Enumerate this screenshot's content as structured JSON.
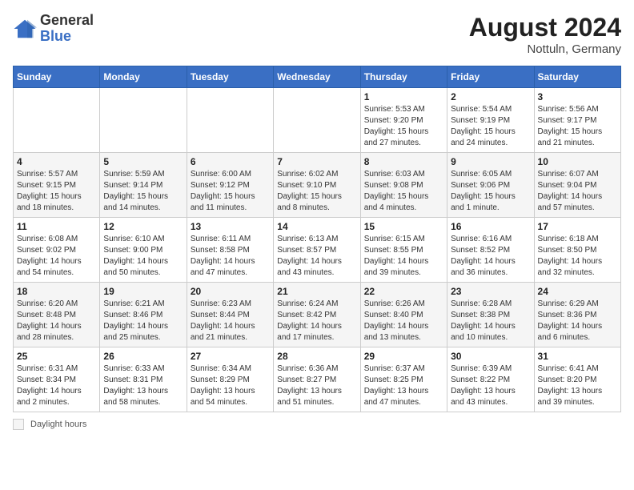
{
  "header": {
    "logo_general": "General",
    "logo_blue": "Blue",
    "month_year": "August 2024",
    "location": "Nottuln, Germany"
  },
  "footer": {
    "daylight_label": "Daylight hours"
  },
  "days_of_week": [
    "Sunday",
    "Monday",
    "Tuesday",
    "Wednesday",
    "Thursday",
    "Friday",
    "Saturday"
  ],
  "weeks": [
    [
      {
        "day": "",
        "sunrise": "",
        "sunset": "",
        "daylight": ""
      },
      {
        "day": "",
        "sunrise": "",
        "sunset": "",
        "daylight": ""
      },
      {
        "day": "",
        "sunrise": "",
        "sunset": "",
        "daylight": ""
      },
      {
        "day": "",
        "sunrise": "",
        "sunset": "",
        "daylight": ""
      },
      {
        "day": "1",
        "sunrise": "Sunrise: 5:53 AM",
        "sunset": "Sunset: 9:20 PM",
        "daylight": "Daylight: 15 hours and 27 minutes."
      },
      {
        "day": "2",
        "sunrise": "Sunrise: 5:54 AM",
        "sunset": "Sunset: 9:19 PM",
        "daylight": "Daylight: 15 hours and 24 minutes."
      },
      {
        "day": "3",
        "sunrise": "Sunrise: 5:56 AM",
        "sunset": "Sunset: 9:17 PM",
        "daylight": "Daylight: 15 hours and 21 minutes."
      }
    ],
    [
      {
        "day": "4",
        "sunrise": "Sunrise: 5:57 AM",
        "sunset": "Sunset: 9:15 PM",
        "daylight": "Daylight: 15 hours and 18 minutes."
      },
      {
        "day": "5",
        "sunrise": "Sunrise: 5:59 AM",
        "sunset": "Sunset: 9:14 PM",
        "daylight": "Daylight: 15 hours and 14 minutes."
      },
      {
        "day": "6",
        "sunrise": "Sunrise: 6:00 AM",
        "sunset": "Sunset: 9:12 PM",
        "daylight": "Daylight: 15 hours and 11 minutes."
      },
      {
        "day": "7",
        "sunrise": "Sunrise: 6:02 AM",
        "sunset": "Sunset: 9:10 PM",
        "daylight": "Daylight: 15 hours and 8 minutes."
      },
      {
        "day": "8",
        "sunrise": "Sunrise: 6:03 AM",
        "sunset": "Sunset: 9:08 PM",
        "daylight": "Daylight: 15 hours and 4 minutes."
      },
      {
        "day": "9",
        "sunrise": "Sunrise: 6:05 AM",
        "sunset": "Sunset: 9:06 PM",
        "daylight": "Daylight: 15 hours and 1 minute."
      },
      {
        "day": "10",
        "sunrise": "Sunrise: 6:07 AM",
        "sunset": "Sunset: 9:04 PM",
        "daylight": "Daylight: 14 hours and 57 minutes."
      }
    ],
    [
      {
        "day": "11",
        "sunrise": "Sunrise: 6:08 AM",
        "sunset": "Sunset: 9:02 PM",
        "daylight": "Daylight: 14 hours and 54 minutes."
      },
      {
        "day": "12",
        "sunrise": "Sunrise: 6:10 AM",
        "sunset": "Sunset: 9:00 PM",
        "daylight": "Daylight: 14 hours and 50 minutes."
      },
      {
        "day": "13",
        "sunrise": "Sunrise: 6:11 AM",
        "sunset": "Sunset: 8:58 PM",
        "daylight": "Daylight: 14 hours and 47 minutes."
      },
      {
        "day": "14",
        "sunrise": "Sunrise: 6:13 AM",
        "sunset": "Sunset: 8:57 PM",
        "daylight": "Daylight: 14 hours and 43 minutes."
      },
      {
        "day": "15",
        "sunrise": "Sunrise: 6:15 AM",
        "sunset": "Sunset: 8:55 PM",
        "daylight": "Daylight: 14 hours and 39 minutes."
      },
      {
        "day": "16",
        "sunrise": "Sunrise: 6:16 AM",
        "sunset": "Sunset: 8:52 PM",
        "daylight": "Daylight: 14 hours and 36 minutes."
      },
      {
        "day": "17",
        "sunrise": "Sunrise: 6:18 AM",
        "sunset": "Sunset: 8:50 PM",
        "daylight": "Daylight: 14 hours and 32 minutes."
      }
    ],
    [
      {
        "day": "18",
        "sunrise": "Sunrise: 6:20 AM",
        "sunset": "Sunset: 8:48 PM",
        "daylight": "Daylight: 14 hours and 28 minutes."
      },
      {
        "day": "19",
        "sunrise": "Sunrise: 6:21 AM",
        "sunset": "Sunset: 8:46 PM",
        "daylight": "Daylight: 14 hours and 25 minutes."
      },
      {
        "day": "20",
        "sunrise": "Sunrise: 6:23 AM",
        "sunset": "Sunset: 8:44 PM",
        "daylight": "Daylight: 14 hours and 21 minutes."
      },
      {
        "day": "21",
        "sunrise": "Sunrise: 6:24 AM",
        "sunset": "Sunset: 8:42 PM",
        "daylight": "Daylight: 14 hours and 17 minutes."
      },
      {
        "day": "22",
        "sunrise": "Sunrise: 6:26 AM",
        "sunset": "Sunset: 8:40 PM",
        "daylight": "Daylight: 14 hours and 13 minutes."
      },
      {
        "day": "23",
        "sunrise": "Sunrise: 6:28 AM",
        "sunset": "Sunset: 8:38 PM",
        "daylight": "Daylight: 14 hours and 10 minutes."
      },
      {
        "day": "24",
        "sunrise": "Sunrise: 6:29 AM",
        "sunset": "Sunset: 8:36 PM",
        "daylight": "Daylight: 14 hours and 6 minutes."
      }
    ],
    [
      {
        "day": "25",
        "sunrise": "Sunrise: 6:31 AM",
        "sunset": "Sunset: 8:34 PM",
        "daylight": "Daylight: 14 hours and 2 minutes."
      },
      {
        "day": "26",
        "sunrise": "Sunrise: 6:33 AM",
        "sunset": "Sunset: 8:31 PM",
        "daylight": "Daylight: 13 hours and 58 minutes."
      },
      {
        "day": "27",
        "sunrise": "Sunrise: 6:34 AM",
        "sunset": "Sunset: 8:29 PM",
        "daylight": "Daylight: 13 hours and 54 minutes."
      },
      {
        "day": "28",
        "sunrise": "Sunrise: 6:36 AM",
        "sunset": "Sunset: 8:27 PM",
        "daylight": "Daylight: 13 hours and 51 minutes."
      },
      {
        "day": "29",
        "sunrise": "Sunrise: 6:37 AM",
        "sunset": "Sunset: 8:25 PM",
        "daylight": "Daylight: 13 hours and 47 minutes."
      },
      {
        "day": "30",
        "sunrise": "Sunrise: 6:39 AM",
        "sunset": "Sunset: 8:22 PM",
        "daylight": "Daylight: 13 hours and 43 minutes."
      },
      {
        "day": "31",
        "sunrise": "Sunrise: 6:41 AM",
        "sunset": "Sunset: 8:20 PM",
        "daylight": "Daylight: 13 hours and 39 minutes."
      }
    ]
  ]
}
